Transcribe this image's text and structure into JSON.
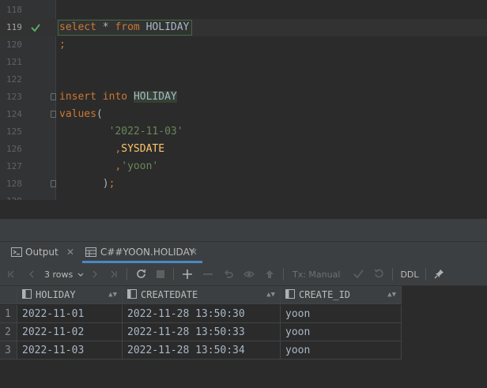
{
  "editor": {
    "lines": [
      {
        "num": "118"
      },
      {
        "num": "119",
        "current": true,
        "parts": [
          {
            "t": "select",
            "c": "kw"
          },
          {
            "t": " ",
            "c": "id"
          },
          {
            "t": "*",
            "c": "id"
          },
          {
            "t": " ",
            "c": "id"
          },
          {
            "t": "from",
            "c": "kw"
          },
          {
            "t": " ",
            "c": "id"
          },
          {
            "t": "HOLIDAY",
            "c": "id"
          }
        ]
      },
      {
        "num": "120",
        "parts": [
          {
            "t": ";",
            "c": "punct"
          }
        ]
      },
      {
        "num": "121"
      },
      {
        "num": "122"
      },
      {
        "num": "123",
        "fold": true,
        "parts": [
          {
            "t": "insert",
            "c": "kw"
          },
          {
            "t": " ",
            "c": "id"
          },
          {
            "t": "into",
            "c": "kw"
          },
          {
            "t": " ",
            "c": "id"
          },
          {
            "t": "HOLIDAY",
            "c": "id hl"
          }
        ]
      },
      {
        "num": "124",
        "fold": true,
        "parts": [
          {
            "t": "values",
            "c": "kw"
          },
          {
            "t": "(",
            "c": "id"
          }
        ]
      },
      {
        "num": "125",
        "parts": [
          {
            "t": "        ",
            "c": "id"
          },
          {
            "t": "'2022-11-03'",
            "c": "str"
          }
        ]
      },
      {
        "num": "126",
        "parts": [
          {
            "t": "         ",
            "c": "id"
          },
          {
            "t": ",",
            "c": "punct"
          },
          {
            "t": "SYSDATE",
            "c": "sysdate"
          }
        ]
      },
      {
        "num": "127",
        "parts": [
          {
            "t": "         ",
            "c": "id"
          },
          {
            "t": ",",
            "c": "punct"
          },
          {
            "t": "'yoon'",
            "c": "str"
          }
        ]
      },
      {
        "num": "128",
        "fold": true,
        "parts": [
          {
            "t": "       ",
            "c": "id"
          },
          {
            "t": ")",
            "c": "id"
          },
          {
            "t": ";",
            "c": "punct"
          }
        ]
      },
      {
        "num": "129"
      }
    ]
  },
  "tabs": {
    "output_label": "Output",
    "result_label": "C##YOON.HOLIDAY",
    "close_glyph": "✕"
  },
  "toolbar": {
    "rows_label": "3 rows",
    "tx_label": "Tx: Manual",
    "ddl_label": "DDL"
  },
  "grid": {
    "columns": [
      "HOLIDAY",
      "CREATEDATE",
      "CREATE_ID"
    ],
    "rows": [
      {
        "num": "1",
        "cells": [
          "2022-11-01",
          "2022-11-28 13:50:30",
          "yoon"
        ]
      },
      {
        "num": "2",
        "cells": [
          "2022-11-02",
          "2022-11-28 13:50:33",
          "yoon"
        ]
      },
      {
        "num": "3",
        "cells": [
          "2022-11-03",
          "2022-11-28 13:50:34",
          "yoon"
        ]
      }
    ]
  },
  "icons": {
    "check": "checkmark-icon",
    "output": "console-icon",
    "table": "table-icon",
    "column": "column-icon"
  },
  "colors": {
    "keyword": "#cc7832",
    "string": "#6a8759",
    "function": "#ffc66d",
    "accent": "#4a88c7",
    "success": "#59a869"
  }
}
